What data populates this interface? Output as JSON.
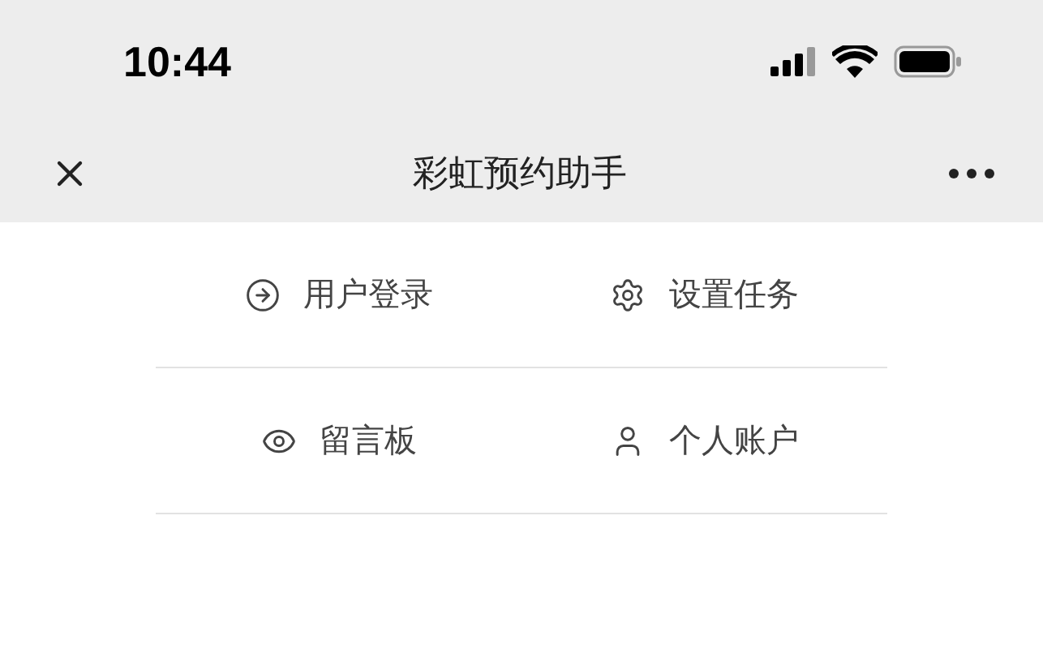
{
  "status_bar": {
    "time": "10:44"
  },
  "nav_bar": {
    "title": "彩虹预约助手"
  },
  "menu": [
    {
      "label": "用户登录",
      "kind": "login"
    },
    {
      "label": "设置任务",
      "kind": "settings"
    },
    {
      "label": "留言板",
      "kind": "messages"
    },
    {
      "label": "个人账户",
      "kind": "account"
    }
  ]
}
